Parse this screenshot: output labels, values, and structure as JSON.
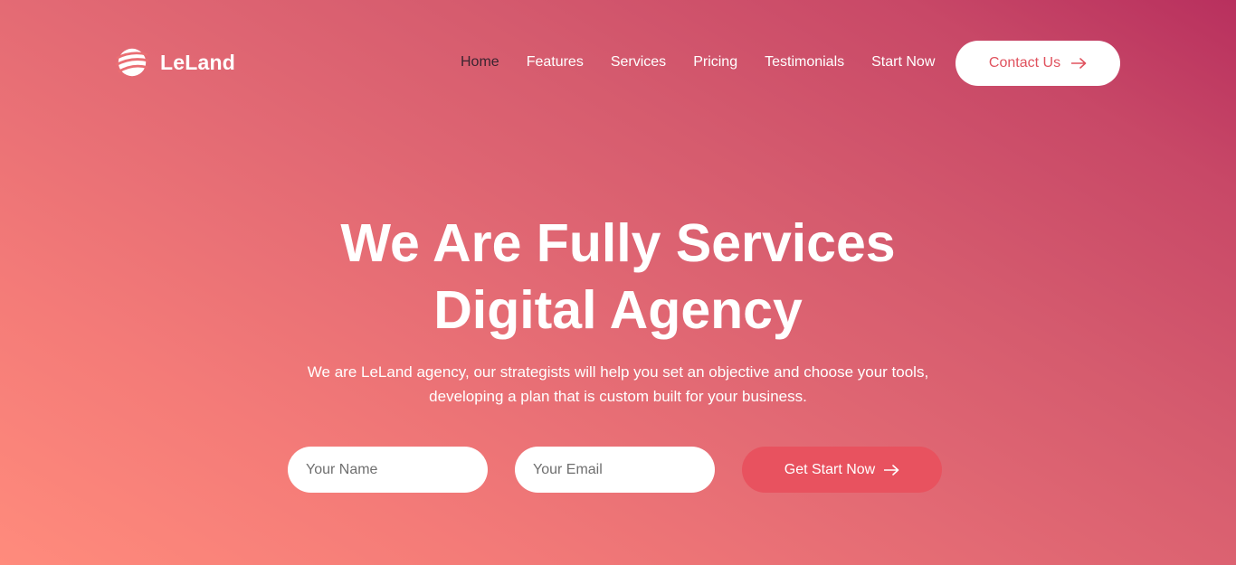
{
  "brand": {
    "name": "LeLand",
    "logo_icon": "globe-swoosh-icon"
  },
  "nav": {
    "items": [
      {
        "label": "Home",
        "active": true
      },
      {
        "label": "Features",
        "active": false
      },
      {
        "label": "Services",
        "active": false
      },
      {
        "label": "Pricing",
        "active": false
      },
      {
        "label": "Testimonials",
        "active": false
      },
      {
        "label": "Start Now",
        "active": false
      }
    ],
    "contact_label": "Contact Us"
  },
  "hero": {
    "title_line1": "We Are Fully Services",
    "title_line2": "Digital Agency",
    "subtitle_line1": "We are LeLand agency, our strategists will help you set an objective and choose your tools,",
    "subtitle_line2": "developing a plan that is custom built for your business."
  },
  "form": {
    "name_placeholder": "Your Name",
    "email_placeholder": "Your Email",
    "submit_label": "Get Start Now"
  },
  "colors": {
    "gradient_light": "#ff8b7c",
    "gradient_dark": "#b8305e",
    "accent": "#e8525f",
    "active_nav": "#3a2430"
  }
}
